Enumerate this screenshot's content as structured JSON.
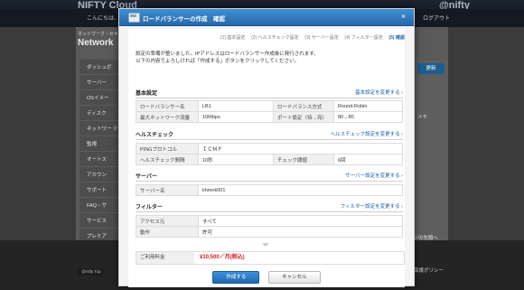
{
  "background": {
    "brand_left": "NIFTY Cloud",
    "brand_right": "@nifty",
    "greeting": "こんにちは、",
    "logout": "ログアウト",
    "network_label": "ネットワーク・セキュ",
    "network_title": "Network",
    "refresh_button": "更新",
    "memo_label": "メモ",
    "sidebar": [
      "ダッシュボ",
      "サーバー",
      "OSイメー",
      "ディスク",
      "ネットワー ティ",
      "監視",
      "オートス",
      "アカウン",
      "サポート"
    ],
    "footer_links": [
      "FAQ・サ",
      "サービス",
      "プレミア"
    ],
    "promo_text": "ージの先頭へ",
    "privacy": "保護ポリシー",
    "badge": "@nifty Top"
  },
  "modal": {
    "title": "ロードバランサーの作成　確認",
    "steps": [
      {
        "label": "(1) 基本設定",
        "active": false
      },
      {
        "label": "(2) ヘルスチェック設定",
        "active": false
      },
      {
        "label": "(3) サーバー設定",
        "active": false
      },
      {
        "label": "(4) フィルター設定",
        "active": false
      },
      {
        "label": "(5) 確認",
        "active": true
      }
    ],
    "intro_line1": "設定の準備が整いました。IPアドレスはロードバランサー作成後に発行されます。",
    "intro_line2": "以下の内容でよろしければ「作成する」ボタンをクリックしてください。",
    "basic": {
      "heading": "基本設定",
      "link": "基本設定を変更する",
      "rows": [
        {
          "l1": "ロードバランサー名",
          "v1": "LB1",
          "l2": "ロードバランス方式",
          "v2": "Round-Robin"
        },
        {
          "l1": "最大ネットワーク流量",
          "v1": "10Mbps",
          "l2": "ポート設定（待→宛）",
          "v2": "80→80"
        }
      ]
    },
    "health": {
      "heading": "ヘルスチェック",
      "link": "ヘルスチェック設定を変更する",
      "rows": [
        {
          "l1": "PINGプロトコル",
          "v1": "ＩＣＭＰ",
          "l2": "",
          "v2": ""
        },
        {
          "l1": "ヘルスチェック間隔",
          "v1": "10秒",
          "l2": "チェック閾値",
          "v2": "6回"
        }
      ]
    },
    "server": {
      "heading": "サーバー",
      "link": "サーバー設定を変更する",
      "row_label": "サーバー名",
      "row_value": "khmnk001"
    },
    "filter": {
      "heading": "フィルター",
      "link": "フィルター設定を変更する",
      "rows": [
        {
          "label": "アクセス元",
          "value": "すべて"
        },
        {
          "label": "動作",
          "value": "許可"
        }
      ]
    },
    "fee": {
      "label": "ご利用料金",
      "value": "¥10,500／月(税込)"
    },
    "create_button": "作成する",
    "cancel_button": "キャンセル"
  }
}
